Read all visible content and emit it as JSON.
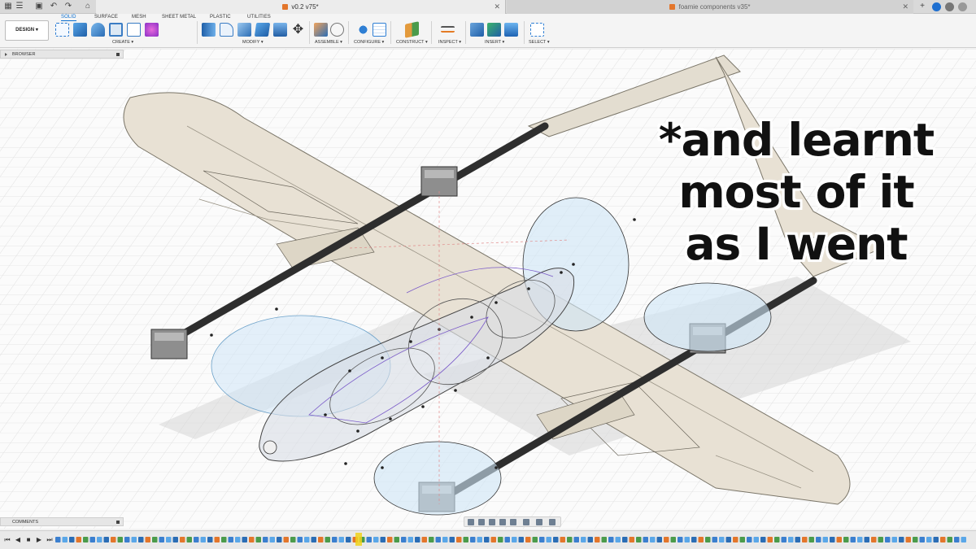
{
  "tabbar": {
    "doc_tab_active": "v0.2 v75*",
    "doc_tab_inactive": "foamie components v35*"
  },
  "ribbon": {
    "workspace_button": "DESIGN",
    "tabs": [
      "SOLID",
      "SURFACE",
      "MESH",
      "SHEET METAL",
      "PLASTIC",
      "UTILITIES"
    ],
    "active_tab": "SOLID",
    "groups": [
      "CREATE",
      "MODIFY",
      "ASSEMBLE",
      "CONFIGURE",
      "CONSTRUCT",
      "INSPECT",
      "INSERT",
      "SELECT"
    ]
  },
  "panels": {
    "browser_label": "BROWSER",
    "comments_label": "COMMENTS"
  },
  "overlay": {
    "caption": "*and learnt\nmost of it\nas I went"
  },
  "colors": {
    "accent": "#0a6fd0",
    "wing_fill": "#e8e1d4",
    "boom": "#333333",
    "prop_disc": "#cfe6f7",
    "sketch": "#7a5ac8"
  },
  "icons": {
    "file": "grid-icon",
    "save": "save-icon",
    "undo": "undo-icon",
    "redo": "redo-icon",
    "home": "home-icon"
  }
}
